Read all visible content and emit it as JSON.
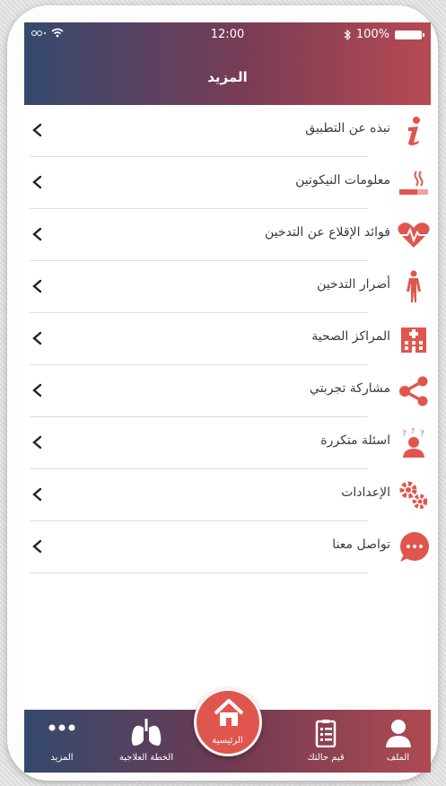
{
  "status": {
    "time": "12:00",
    "battery": "100%"
  },
  "header": {
    "title": "المزيد"
  },
  "menu": {
    "items": [
      {
        "label": "نبذه عن التطبيق",
        "icon": "info-icon"
      },
      {
        "label": "معلومات النيكوتين",
        "icon": "cigarette-icon"
      },
      {
        "label": "فوائد الإقلاع عن التدخين",
        "icon": "heart-pulse-icon"
      },
      {
        "label": "أضرار التدخين",
        "icon": "body-icon"
      },
      {
        "label": "المراكز الصحية",
        "icon": "hospital-icon"
      },
      {
        "label": "مشاركة تجربتي",
        "icon": "share-icon"
      },
      {
        "label": "اسئلة متكررة",
        "icon": "question-person-icon"
      },
      {
        "label": "الإعدادات",
        "icon": "gears-icon"
      },
      {
        "label": "تواصل معنا",
        "icon": "chat-icon"
      }
    ]
  },
  "tabbar": {
    "more": "المزيد",
    "plan": "الخطة العلاجية",
    "home": "الرئيسية",
    "values": "قيم حالتك",
    "profile": "الملف"
  },
  "colors": {
    "accent": "#e0564e",
    "header_start": "#34496e",
    "header_end": "#b74a53"
  }
}
